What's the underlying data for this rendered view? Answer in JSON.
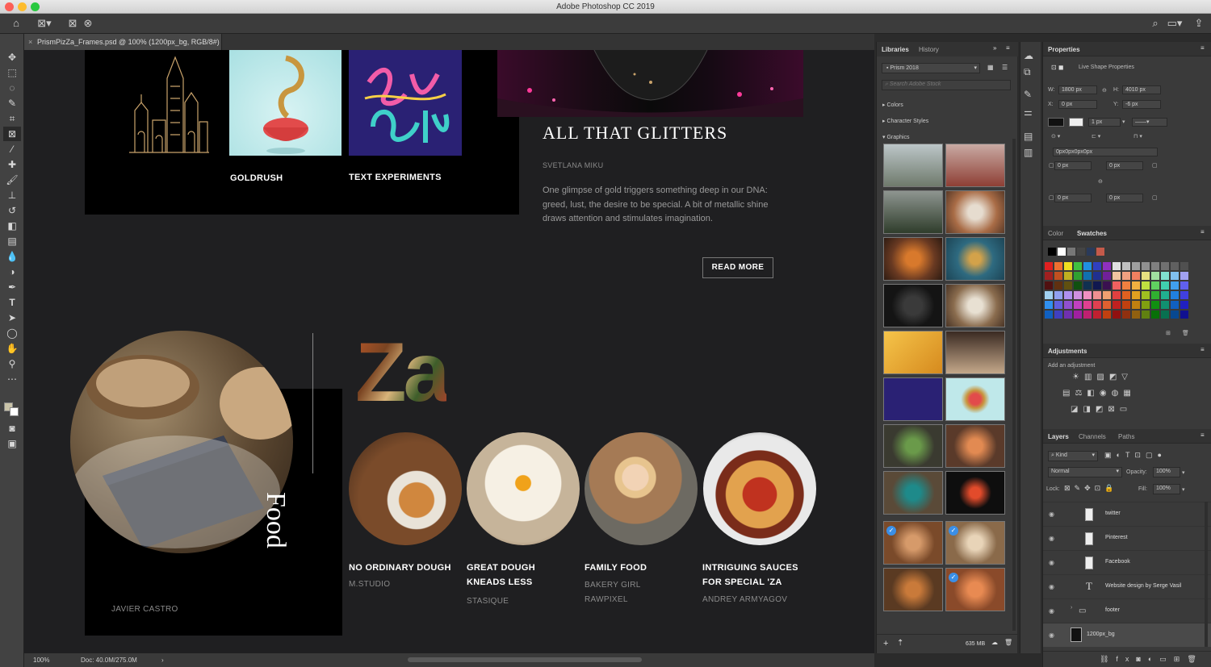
{
  "window": {
    "title": "Adobe Photoshop CC 2019"
  },
  "document_tab": {
    "label": "PrismPizZa_Frames.psd @ 100% (1200px_bg, RGB/8#)"
  },
  "status": {
    "zoom": "100%",
    "doc": "Doc: 40.0M/275.0M"
  },
  "canvas": {
    "cards": [
      {
        "title": "GOLDRUSH"
      },
      {
        "title": "TEXT EXPERIMENTS"
      }
    ],
    "article": {
      "heading": "ALL THAT GLITTERS",
      "author": "SVETLANA MIKU",
      "body": "One glimpse of gold triggers something deep in our DNA: greed, lust, the desire to be special. A bit of metallic shine draws attention and stimulates imagination.",
      "cta": "READ MORE"
    },
    "food_vertical": "Food",
    "food_credit": "JAVIER CASTRO",
    "za_title": "Za",
    "food_items": [
      {
        "title": "NO ORDINARY DOUGH",
        "title2": "",
        "sub1": "M.STUDIO",
        "sub2": ""
      },
      {
        "title": "GREAT DOUGH",
        "title2": "KNEADS LESS",
        "sub1": "STASIQUE",
        "sub2": ""
      },
      {
        "title": "FAMILY FOOD",
        "title2": "",
        "sub1": "BAKERY GIRL",
        "sub2": "RAWPIXEL"
      },
      {
        "title": "INTRIGUING SAUCES",
        "title2": "FOR SPECIAL 'ZA",
        "sub1": "ANDREY ARMYAGOV",
        "sub2": ""
      }
    ]
  },
  "libraries": {
    "tabs": [
      "Libraries",
      "History"
    ],
    "library_name": "Prism 2018",
    "search_placeholder": "Search Adobe Stock",
    "sections": [
      "Colors",
      "Character Styles",
      "Graphics"
    ],
    "storage": "635 MB"
  },
  "properties": {
    "tab": "Properties",
    "subtitle": "Live Shape Properties",
    "w_label": "W:",
    "w": "1800 px",
    "h_label": "H:",
    "h": "4010 px",
    "x_label": "X:",
    "x": "0 px",
    "y_label": "Y:",
    "y": "-6 px",
    "stroke": "1 px",
    "corners": "0px0px0px0px",
    "c1": "0 px",
    "c2": "0 px",
    "c3": "0 px",
    "c4": "0 px"
  },
  "color_panel": {
    "tabs": [
      "Color",
      "Swatches"
    ]
  },
  "adjustments": {
    "title": "Adjustments",
    "hint": "Add an adjustment"
  },
  "layers_panel": {
    "tabs": [
      "Layers",
      "Channels",
      "Paths"
    ],
    "kind": "Kind",
    "blend": "Normal",
    "opacity_label": "Opacity:",
    "opacity": "100%",
    "lock_label": "Lock:",
    "fill_label": "Fill:",
    "fill": "100%",
    "layers": [
      {
        "name": "twitter"
      },
      {
        "name": "Pinterest"
      },
      {
        "name": "Facebook"
      },
      {
        "name": "Website design by Serge Vasil"
      },
      {
        "name": "footer"
      },
      {
        "name": "1200px_bg"
      }
    ]
  },
  "colors": {
    "canvas_bg": "#1f1f21",
    "card_bg": "#000000",
    "panel_bg": "#3a3a3a",
    "accent_gold": "#c9a36b"
  }
}
